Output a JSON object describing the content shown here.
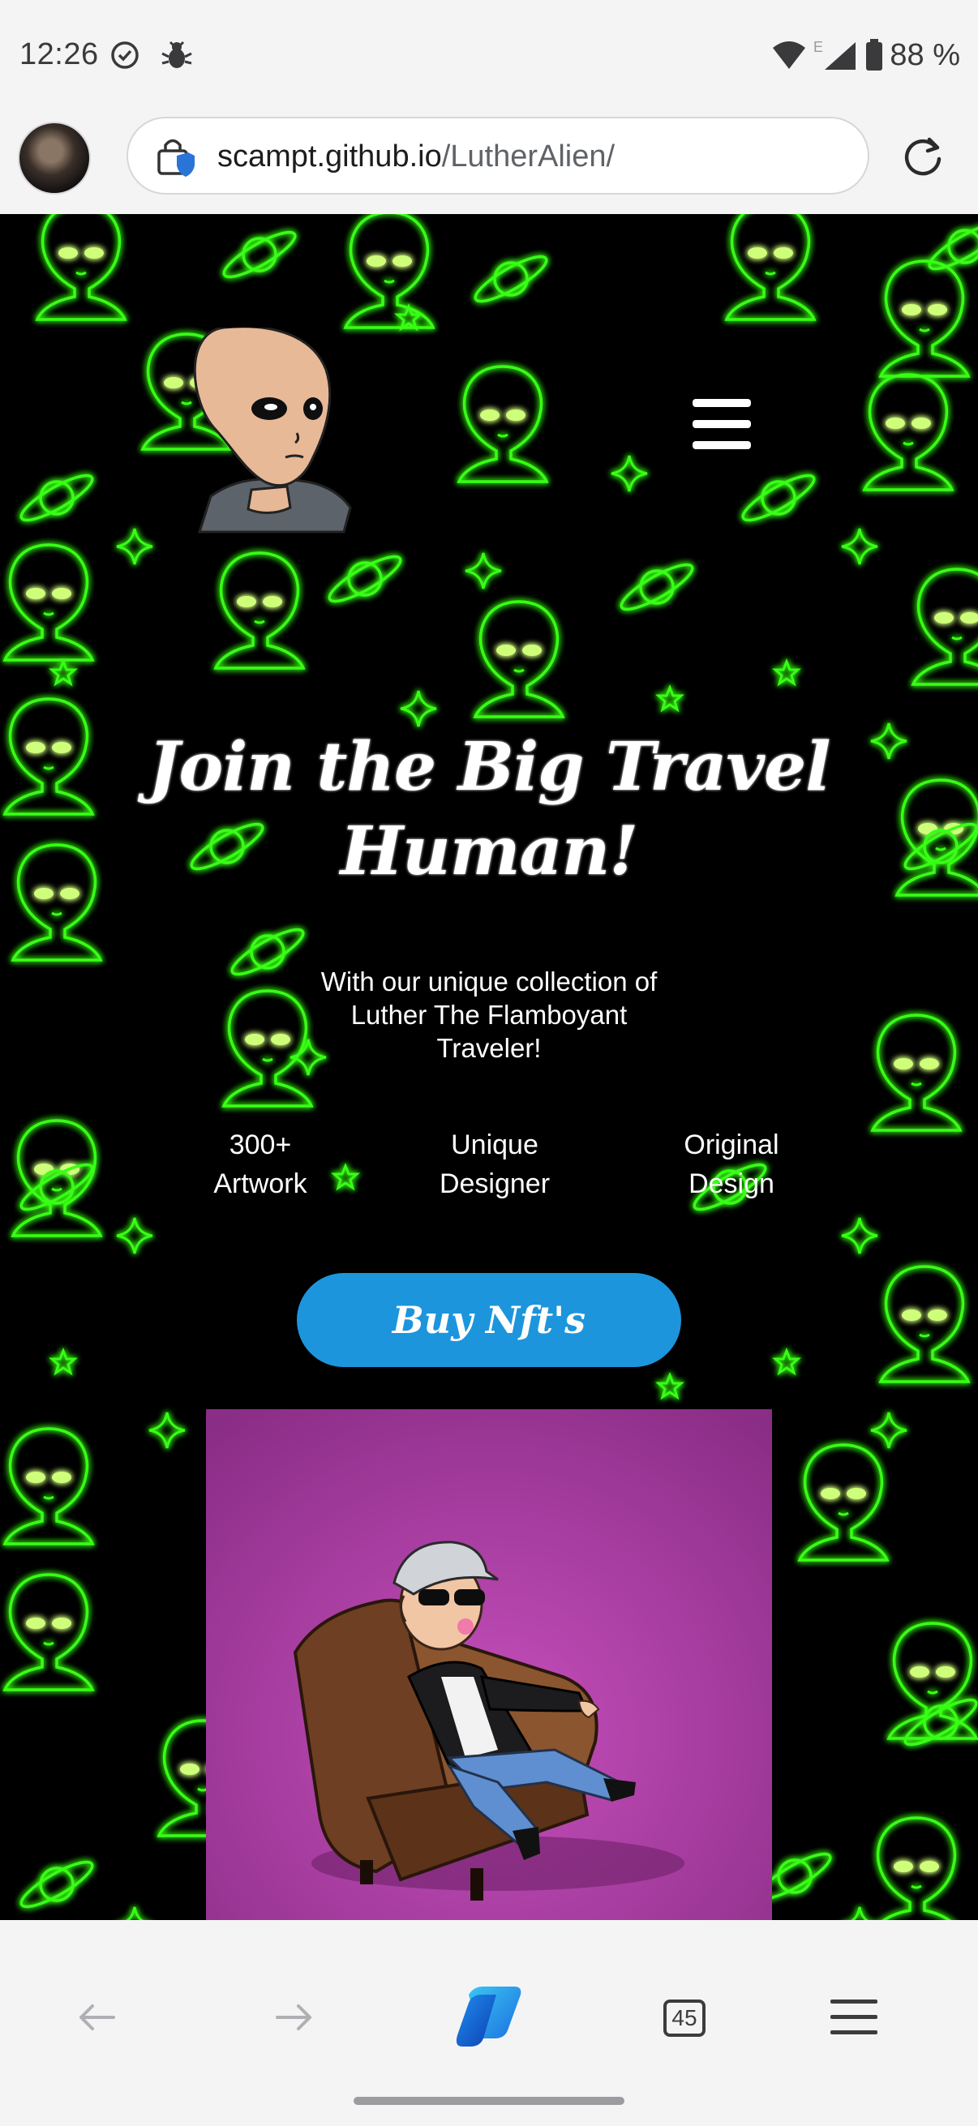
{
  "status_bar": {
    "time": "12:26",
    "network_label": "E",
    "battery": "88 %",
    "icons": [
      "check-circle-icon",
      "bug-icon",
      "wifi-icon",
      "signal-icon",
      "battery-icon"
    ]
  },
  "browser": {
    "url_host": "scampt.github.io",
    "url_path": "/LutherAlien/",
    "tab_count": "45",
    "icons": [
      "avatar",
      "lock-shield-icon",
      "reload-icon",
      "back-arrow-icon",
      "forward-arrow-icon",
      "copilot-icon",
      "tabs-icon",
      "menu-icon"
    ]
  },
  "page": {
    "hero_title_line1": "Join the Big Travel",
    "hero_title_line2": "Human!",
    "hero_subtitle_line1": "With our unique collection of",
    "hero_subtitle_line2": "Luther The Flamboyant",
    "hero_subtitle_line3": "Traveler!",
    "stats": [
      {
        "line1": "300+",
        "line2": "Artwork"
      },
      {
        "line1": "Unique",
        "line2": "Designer"
      },
      {
        "line1": "Original",
        "line2": "Design"
      }
    ],
    "cta_label": "Buy Nft's",
    "colors": {
      "background": "#000000",
      "neon": "#39ff14",
      "button": "#1d95dc",
      "nft_background": "#b13fa6"
    }
  }
}
